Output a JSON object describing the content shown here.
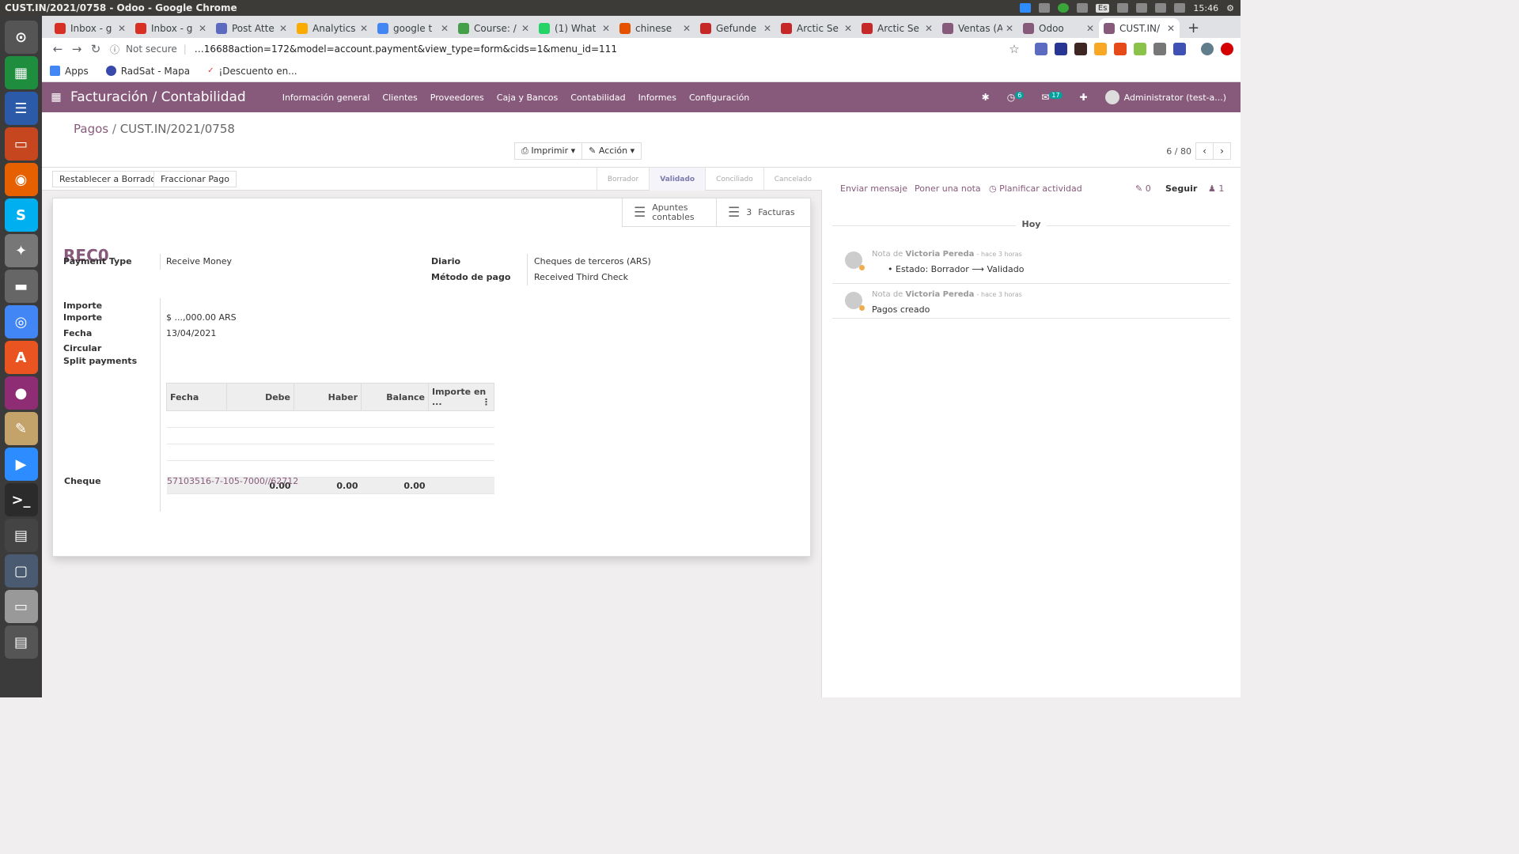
{
  "os": {
    "window_title": "CUST.IN/2021/0758 - Odoo - Google Chrome",
    "lang": "Es",
    "clock": "15:46"
  },
  "dock": {
    "items": [
      "settings",
      "spreadsheet",
      "document",
      "presentation",
      "firefox",
      "skype",
      "tools",
      "disk",
      "chrome",
      "store",
      "browser",
      "notes",
      "zoom",
      "terminal",
      "video",
      "window",
      "drive",
      "printer"
    ]
  },
  "browser": {
    "tabs": [
      {
        "label": "Inbox - g",
        "color": "#d93025"
      },
      {
        "label": "Inbox - g",
        "color": "#d93025"
      },
      {
        "label": "Post Atte",
        "color": "#5c6bc0"
      },
      {
        "label": "Analytics",
        "color": "#f9ab00"
      },
      {
        "label": "google t",
        "color": "#4285f4"
      },
      {
        "label": "Course: /",
        "color": "#43a047"
      },
      {
        "label": "(1) What",
        "color": "#25d366"
      },
      {
        "label": "chinese",
        "color": "#e65100"
      },
      {
        "label": "Gefunde",
        "color": "#c62828"
      },
      {
        "label": "Arctic Se",
        "color": "#c62828"
      },
      {
        "label": "Arctic Se",
        "color": "#c62828"
      },
      {
        "label": "Ventas (A",
        "color": "#875a7b"
      },
      {
        "label": "Odoo",
        "color": "#875a7b"
      },
      {
        "label": "CUST.IN/",
        "color": "#875a7b"
      }
    ],
    "new_tab": "+",
    "security": "Not secure",
    "url": "…16688action=172&model=account.payment&view_type=form&cids=1&menu_id=111"
  },
  "bookmarks": [
    {
      "label": "Apps"
    },
    {
      "label": "RadSat - Mapa"
    },
    {
      "label": "¡Descuento en..."
    }
  ],
  "odoo_nav": {
    "brand": "Facturación / Contabilidad",
    "menus": [
      "Información general",
      "Clientes",
      "Proveedores",
      "Caja y Bancos",
      "Contabilidad",
      "Informes",
      "Configuración"
    ],
    "activity_count": "6",
    "message_count": "17",
    "user": "Administrator (test-a...)"
  },
  "control_panel": {
    "breadcrumb_parent": "Pagos",
    "breadcrumb_current": "CUST.IN/2021/0758",
    "print_label": "Imprimir",
    "action_label": "Acción",
    "pager_value": "6 / 80"
  },
  "statusbar": {
    "buttons": [
      "Restablecer a Borrador",
      "Fraccionar Pago"
    ],
    "states": [
      "Borrador",
      "Validado",
      "Conciliado",
      "Cancelado"
    ],
    "active_state": "Validado"
  },
  "form": {
    "smart_buttons": [
      {
        "count": "",
        "label": "Apuntes contables"
      },
      {
        "count": "3",
        "label": "Facturas"
      }
    ],
    "name": "REC0",
    "payment_type_label": "Payment Type",
    "payment_type": "Receive Money",
    "diario_label": "Diario",
    "diario": "Cheques de terceros (ARS)",
    "metodo_label": "Método de pago",
    "metodo": "Received Third Check",
    "importe_label_1": "Importe",
    "importe_label_2": "Importe",
    "importe": "$ ...,000.00 ARS",
    "fecha_label": "Fecha",
    "fecha": "13/04/2021",
    "circular_label": "Circular",
    "split_label": "Split payments",
    "split_table": {
      "columns": [
        "Fecha",
        "Debe",
        "Haber",
        "Balance",
        "Importe en ..."
      ],
      "totals": [
        "0.00",
        "0.00",
        "0.00"
      ]
    },
    "cheque_label": "Cheque",
    "cheque": "57103516-7-105-7000//62712"
  },
  "chatter": {
    "send_message": "Enviar mensaje",
    "log_note": "Poner una nota",
    "schedule": "Planificar actividad",
    "attachments": "0",
    "follow": "Seguir",
    "followers": "1",
    "today": "Hoy",
    "messages": [
      {
        "prefix": "Nota de",
        "author": "Victoria Pereda",
        "time": "- hace 3 horas",
        "body": "Estado: Borrador ⟶ Validado"
      },
      {
        "prefix": "Nota de",
        "author": "Victoria Pereda",
        "time": "- hace 3 horas",
        "body": "Pagos creado"
      }
    ]
  }
}
